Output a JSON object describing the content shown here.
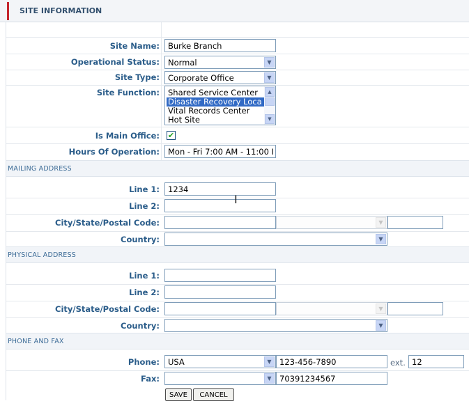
{
  "header": {
    "title": "SITE INFORMATION"
  },
  "site": {
    "name_label": "Site Name:",
    "name_value": "Burke Branch",
    "status_label": "Operational Status:",
    "status_value": "Normal",
    "type_label": "Site Type:",
    "type_value": "Corporate Office",
    "function_label": "Site Function:",
    "function_options": [
      "Shared Service Center",
      "Disaster Recovery Loca",
      "Vital Records Center",
      "Hot Site"
    ],
    "function_selected_index": 1,
    "main_office_label": "Is Main Office:",
    "main_office_checked": true,
    "hours_label": "Hours Of Operation:",
    "hours_value": "Mon - Fri 7:00 AM - 11:00 I"
  },
  "mailing": {
    "section_title": "MAILING ADDRESS",
    "line1_label": "Line 1:",
    "line1_value": "1234",
    "line2_label": "Line 2:",
    "line2_value": "",
    "city_label": "City/State/Postal Code:",
    "city_value": "",
    "state_value": "",
    "postal_value": "",
    "country_label": "Country:",
    "country_value": ""
  },
  "physical": {
    "section_title": "PHYSICAL ADDRESS",
    "line1_label": "Line 1:",
    "line1_value": "",
    "line2_label": "Line 2:",
    "line2_value": "",
    "city_label": "City/State/Postal Code:",
    "city_value": "",
    "state_value": "",
    "postal_value": "",
    "country_label": "Country:",
    "country_value": ""
  },
  "phonefax": {
    "section_title": "PHONE AND FAX",
    "phone_label": "Phone:",
    "phone_country": "USA",
    "phone_number": "123-456-7890",
    "ext_label": "ext.",
    "ext_value": "12",
    "fax_label": "Fax:",
    "fax_country": "",
    "fax_number": "70391234567"
  },
  "buttons": {
    "save": "SAVE",
    "cancel": "CANCEL"
  },
  "icons": {
    "dropdown": "chevron-down-icon",
    "check": "check-icon",
    "cursor": "text-cursor-icon"
  },
  "colors": {
    "accent": "#c4262e",
    "label": "#2b5d8a",
    "section_text": "#3c6b96",
    "selection": "#316ac5"
  }
}
